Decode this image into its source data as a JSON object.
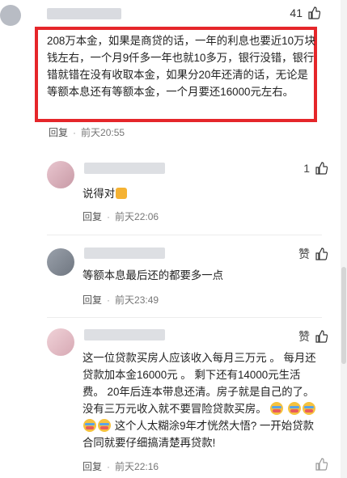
{
  "top_comment": {
    "like_count": "41",
    "text": "208万本金，如果是商贷的话，一年的利息也要近10万块钱左右，一个月9仟多一年也就10多万，银行没错，银行错就错在没有收取本金，如果分20年还清的话，无论是等额本息还有等额本金，一个月要还16000元左右。",
    "reply_label": "回复",
    "time": "前天20:55"
  },
  "comments": [
    {
      "like": "1",
      "text": "说得对",
      "reply_label": "回复",
      "time": "前天22:06"
    },
    {
      "like": "赞",
      "text": "等额本息最后还的都要多一点",
      "reply_label": "回复",
      "time": "前天23:49"
    },
    {
      "like": "赞",
      "text_part1": "这一位贷款买房人应该收入每月三万元 。 每月还贷款加本金16000元 。 剩下还有14000元生活费。 20年后连本带息还清。房子就是自己的了。 没有三万元收入就不要冒险贷款买房。",
      "text_part2": " 这个人太糊涂9年才恍然大悟? 一开始贷款合同就要仔细搞清楚再贷款!",
      "reply_label": "回复",
      "time": "前天22:16"
    }
  ],
  "colors": {
    "highlight": "#e5262a",
    "meta": "#777777"
  }
}
